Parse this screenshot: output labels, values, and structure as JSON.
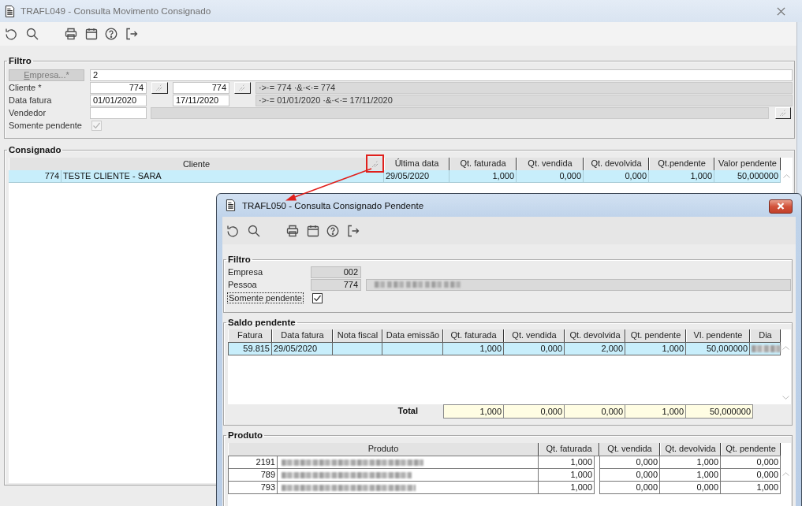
{
  "main_window": {
    "title": "TRAFL049 - Consulta Movimento Consignado"
  },
  "filtro": {
    "title": "Filtro",
    "rows": [
      {
        "kind": "button-field",
        "label": "Empresa...*",
        "value": "2"
      },
      {
        "kind": "code-range",
        "label": "Cliente *",
        "from": "774",
        "to": "774",
        "summary": "·>·= 774 ·&·<·= 774"
      },
      {
        "kind": "date-range",
        "label": "Data fatura",
        "from": "01/01/2020",
        "to": "17/11/2020",
        "summary": "·>·= 01/01/2020 ·&·<·= 17/11/2020"
      },
      {
        "kind": "lookup",
        "label": "Vendedor"
      },
      {
        "kind": "checkbox",
        "label": "Somente pendente",
        "checked": true,
        "disabled": true
      }
    ]
  },
  "consignado": {
    "title": "Consignado",
    "columns": [
      "Cliente",
      "Última data",
      "Qt. faturada",
      "Qt. vendida",
      "Qt. devolvida",
      "Qt.pendente",
      "Valor pendente"
    ],
    "rows": [
      {
        "selected": true,
        "client_code": "774",
        "cells": [
          "TESTE CLIENTE - SARA",
          "29/05/2020",
          "1,000",
          "0,000",
          "0,000",
          "1,000",
          "50,000000"
        ]
      }
    ]
  },
  "dialog": {
    "title": "TRAFL050 - Consulta Consignado Pendente",
    "filtro": {
      "title": "Filtro",
      "fields": [
        {
          "kind": "code",
          "label": "Empresa",
          "value": "002"
        },
        {
          "kind": "code-name",
          "label": "Pessoa",
          "value": "774"
        }
      ],
      "checkbox": {
        "label": "Somente pendente",
        "checked": true,
        "focused": true
      }
    },
    "saldo_pendente": {
      "title": "Saldo pendente",
      "columns": [
        "Fatura",
        "Data fatura",
        "Nota fiscal",
        "Data emissão",
        "Qt. faturada",
        "Qt. vendida",
        "Qt. devolvida",
        "Qt. pendente",
        "Vl. pendente",
        "Dia"
      ],
      "rows": [
        {
          "selected": true,
          "cells": [
            "59.815",
            "29/05/2020",
            null,
            null,
            "1,000",
            "0,000",
            "2,000",
            "1,000",
            "50,000000"
          ]
        }
      ],
      "total": {
        "label": "Total",
        "values": [
          "1,000",
          "0,000",
          "0,000",
          "1,000",
          "50,000000"
        ]
      }
    },
    "produto": {
      "title": "Produto",
      "columns": [
        "Produto",
        "Qt. faturada",
        "Qt. vendida",
        "Qt. devolvida",
        "Qt. pendente"
      ],
      "rows": [
        {
          "selected": false,
          "code": "2191",
          "values": [
            "1,000",
            "0,000",
            "1,000",
            "0,000"
          ]
        },
        {
          "selected": false,
          "code": "789",
          "values": [
            "1,000",
            "0,000",
            "1,000",
            "0,000"
          ]
        },
        {
          "selected": false,
          "code": "793",
          "values": [
            "1,000",
            "0,000",
            "0,000",
            "1,000"
          ]
        }
      ]
    }
  }
}
